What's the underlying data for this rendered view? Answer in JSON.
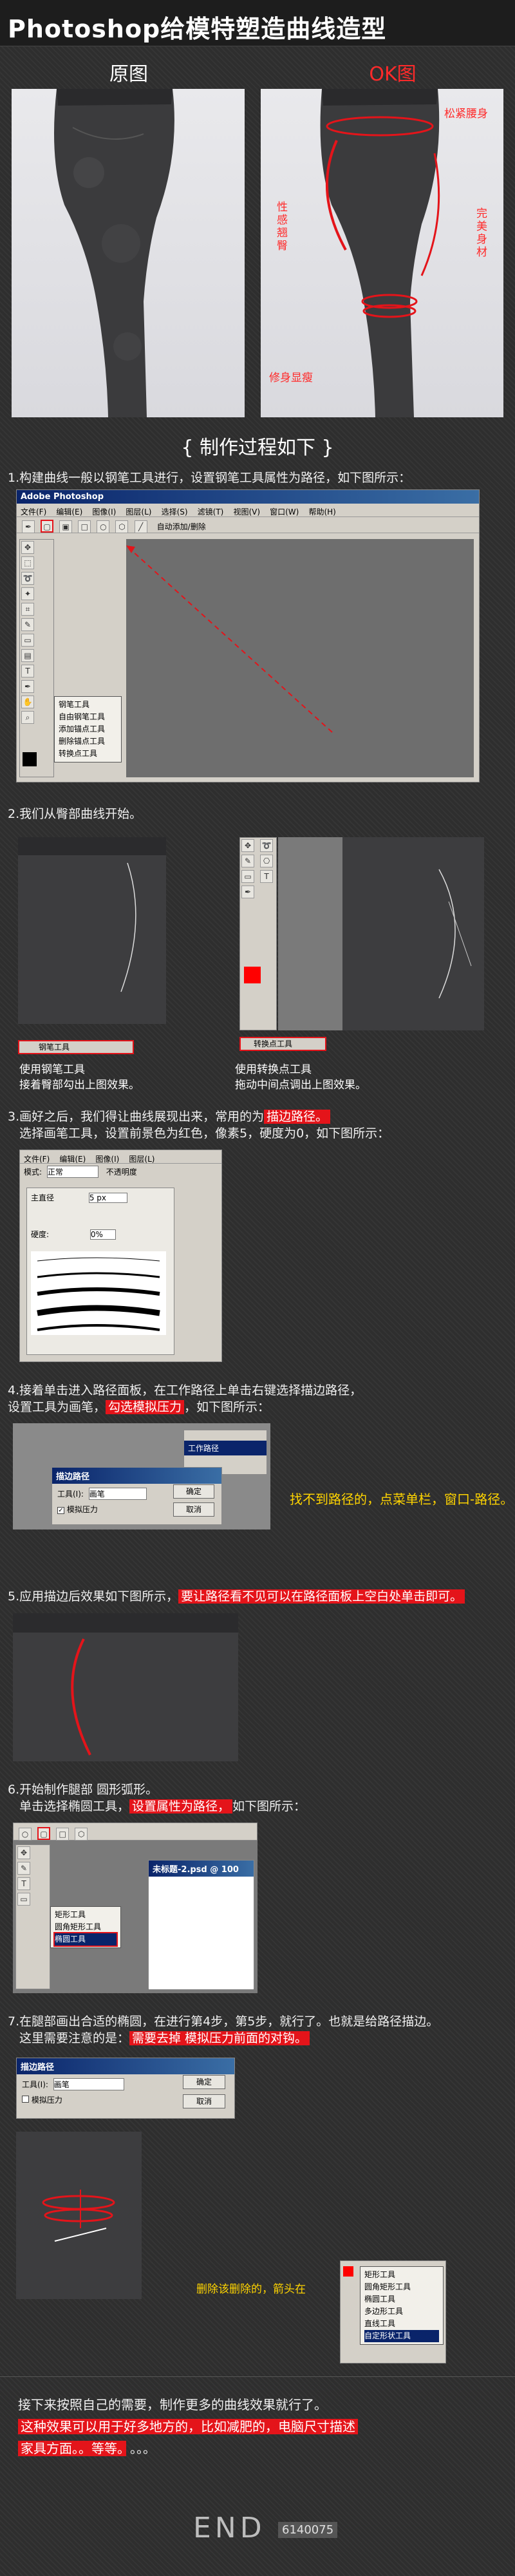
{
  "title": "Photoshop给模特塑造曲线造型",
  "before_label": "原图",
  "after_label": "OK图",
  "annotations": {
    "waist": "松紧腰身",
    "hip": "性感翘臀",
    "leg": "完美身材",
    "calf": "修身显瘦"
  },
  "process_heading": "{ 制作过程如下 }",
  "steps": {
    "s1": "1.构建曲线一般以钢笔工具进行，设置钢笔工具属性为路径，如下图所示：",
    "s2": "2.我们从臀部曲线开始。",
    "s2_left_caption1": "使用钢笔工具",
    "s2_left_caption2": "接着臀部勾出上图效果。",
    "s2_right_caption1": "使用转换点工具",
    "s2_right_caption2": "拖动中间点调出上图效果。",
    "s3_a": "3.画好之后，我们得让曲线展现出来，常用的为",
    "s3_hl": "描边路径。",
    "s3_b": "选择画笔工具，设置前景色为红色，像素5，硬度为0，如下图所示：",
    "s4_a": "4.接着单击进入路径面板，在工作路径上单击右键选择描边路径，",
    "s4_b": "设置工具为画笔，",
    "s4_hl": "勾选模拟压力",
    "s4_c": "，如下图所示：",
    "s4_note": "找不到路径的，点菜单栏，窗口-路径。",
    "s5_a": "5.应用描边后效果如下图所示，",
    "s5_hl": "要让路径看不见可以在路径面板上空白处单击即可。",
    "s6_a": "6.开始制作腿部 圆形弧形。",
    "s6_b": "单击选择椭圆工具，",
    "s6_hl": "设置属性为路径，",
    "s6_c": "如下图所示：",
    "s7_a": "7.在腿部画出合适的椭圆，在进行第4步，第5步，就行了。也就是给路径描边。",
    "s7_b": "这里需要注意的是：",
    "s7_hl": "需要去掉 模拟压力前面的对钩。",
    "s7_note": "删除该删除的，箭头在"
  },
  "ps": {
    "app_title": "Adobe Photoshop",
    "menu": [
      "文件(F)",
      "编辑(E)",
      "图像(I)",
      "图层(L)",
      "选择(S)",
      "滤镜(T)",
      "视图(V)",
      "窗口(W)",
      "帮助(H)"
    ],
    "auto_add": "自动添加/删除",
    "pen_flyout": [
      "钢笔工具",
      "自由钢笔工具",
      "添加锚点工具",
      "删除锚点工具",
      "转换点工具"
    ],
    "pen_tool_label": "钢笔工具",
    "convert_tool_label": "转换点工具",
    "brush_mode_label": "模式:",
    "brush_mode_value": "正常",
    "brush_opacity": "不透明度",
    "brush_main": "主直径",
    "brush_size": "5 px",
    "brush_hardness": "硬度:",
    "brush_hardness_value": "0%",
    "path_panel_item": "工作路径",
    "stroke_dialog_title": "描边路径",
    "stroke_tool_label": "工具(I):",
    "stroke_tool_value": "画笔",
    "simulate_pressure": "模拟压力",
    "ok": "确定",
    "cancel": "取消",
    "doc_title": "未标题-2.psd @ 100",
    "shape_flyout": [
      "矩形工具",
      "圆角矩形工具",
      "椭圆工具",
      "多边形工具",
      "直线工具",
      "自定形状工具"
    ]
  },
  "ending": {
    "line1": "接下来按照自己的需要，制作更多的曲线效果就行了。",
    "line2_a": "这种效果可以用于好多地方的，比如减肥的，电脑尺寸描述",
    "line3": "家具方面。。等等。",
    "dots": "。。。",
    "end_text": "END",
    "stamp": "6140075"
  },
  "colors": {
    "accent_red": "#e4141a",
    "note_yellow": "#ffd400",
    "background": "#2e2e2e"
  }
}
